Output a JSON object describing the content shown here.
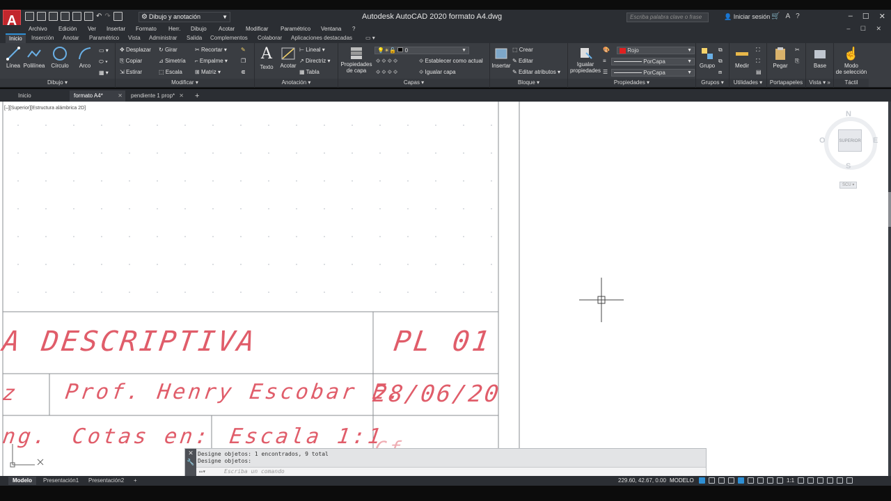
{
  "app": {
    "logo_letter": "A",
    "window_title": "Autodesk AutoCAD 2020    formato A4.dwg",
    "workspace": "Dibujo y anotación",
    "search_placeholder": "Escriba palabra clave o frase",
    "sign_in": "Iniciar sesión",
    "window_controls": [
      "–",
      "☐",
      "✕"
    ],
    "mdi_controls": "– ☐ ✕"
  },
  "menu": [
    "Archivo",
    "Edición",
    "Ver",
    "Insertar",
    "Formato",
    "Herr.",
    "Dibujo",
    "Acotar",
    "Modificar",
    "Paramétrico",
    "Ventana",
    "?"
  ],
  "ribbon_tabs": [
    "Inicio",
    "Inserción",
    "Anotar",
    "Paramétrico",
    "Vista",
    "Administrar",
    "Salida",
    "Complementos",
    "Colaborar",
    "Aplicaciones destacadas"
  ],
  "ribbon": {
    "dibujo": {
      "title": "Dibujo",
      "linea": "Línea",
      "polilinea": "Polilínea",
      "circulo": "Círculo",
      "arco": "Arco"
    },
    "modificar": {
      "title": "Modificar",
      "desplazar": "Desplazar",
      "girar": "Girar",
      "recortar": "Recortar",
      "copiar": "Copiar",
      "simetria": "Simetría",
      "empalme": "Empalme",
      "estirar": "Estirar",
      "escala": "Escala",
      "matriz": "Matriz"
    },
    "anotacion": {
      "title": "Anotación",
      "texto": "Texto",
      "acotar": "Acotar",
      "lineal": "Lineal",
      "directriz": "Directriz",
      "tabla": "Tabla"
    },
    "capas": {
      "title": "Capas",
      "propiedades_1": "Propiedades",
      "propiedades_2": "de capa",
      "layer_value": "0",
      "establecer": "Establecer como actual",
      "igualar_capa": "Igualar capa"
    },
    "bloque": {
      "title": "Bloque",
      "insertar": "Insertar",
      "crear": "Crear",
      "editar": "Editar",
      "editar_atributos": "Editar atributos"
    },
    "propiedades": {
      "title": "Propiedades",
      "igualar_1": "Igualar",
      "igualar_2": "propiedades",
      "color_value": "Rojo",
      "linetype_value": "PorCapa",
      "lineweight_value": "PorCapa"
    },
    "grupos": {
      "title": "Grupos",
      "grupo": "Grupo"
    },
    "utilidades": {
      "title": "Utilidades",
      "medir": "Medir"
    },
    "portapapeles": {
      "title": "Portapapeles",
      "pegar": "Pegar"
    },
    "vista": {
      "title": "Vista",
      "base": "Base"
    },
    "tactil": {
      "title": "Táctil",
      "modo_1": "Modo",
      "modo_2": "de selección"
    }
  },
  "file_tabs": [
    {
      "label": "Inicio"
    },
    {
      "label": "formato A4*"
    },
    {
      "label": "pendiente 1 prop*"
    }
  ],
  "viewport": {
    "label": "[–][Superior][Estructura alámbrica 2D]",
    "viewcube": {
      "n": "N",
      "s": "S",
      "e": "E",
      "w": "O",
      "face": "SUPERIOR",
      "ucs": "SCU"
    }
  },
  "drawing": {
    "title_text": "A  DESCRIPTIVA",
    "sheet_number": "PL  01",
    "prof_prefix": "z",
    "professor": "Prof.  Henry  Escobar  E.",
    "date": "28/06/20",
    "ing_text": "ng.",
    "cotas": "Cotas  en:",
    "escala": "Escala  1:1",
    "cf": "Cf"
  },
  "command_line": {
    "history_1": "Designe objetos: 1 encontrados, 9 total",
    "history_2": "Designe objetos:",
    "placeholder": "Escriba un comando"
  },
  "layout_tabs": [
    "Modelo",
    "Presentación1",
    "Presentación2"
  ],
  "status_bar": {
    "coordinates": "229.60, 42.67, 0.00",
    "model": "MODELO",
    "scale": "1:1"
  },
  "colors": {
    "accent": "#2e8fd4",
    "drawing_text": "#e05d6a",
    "color_swatch": "#e02020"
  }
}
